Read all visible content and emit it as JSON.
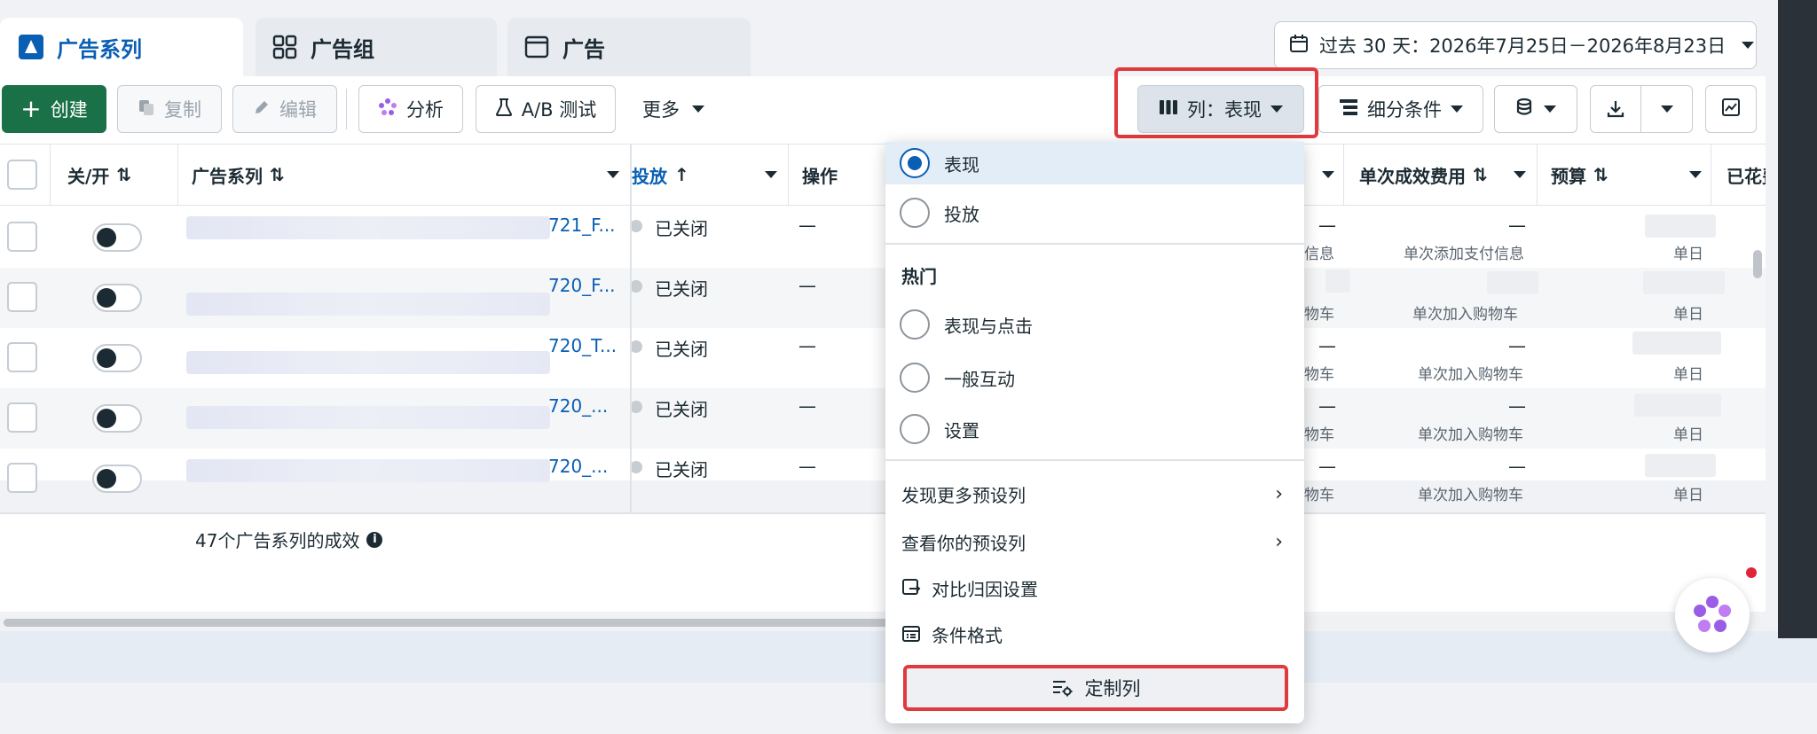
{
  "tabs": [
    {
      "label": "广告系列",
      "icon": "campaign-icon",
      "active": true
    },
    {
      "label": "广告组",
      "icon": "adset-grid-icon",
      "active": false
    },
    {
      "label": "广告",
      "icon": "ad-window-icon",
      "active": false
    }
  ],
  "date_range": {
    "label": "过去 30 天：2026年7月25日－2026年8月23日",
    "icon": "calendar-icon"
  },
  "toolbar": {
    "create": "创建",
    "copy": "复制",
    "edit": "编辑",
    "analyze": "分析",
    "ab_test": "A/B 测试",
    "more": "更多",
    "columns": "列：表现",
    "breakdown": "细分条件"
  },
  "table": {
    "headers": {
      "toggle": "关/开",
      "campaign": "广告系列",
      "delivery": "投放",
      "actions": "操作",
      "cost_per_result": "单次成效费用",
      "budget": "预算",
      "spent": "已花费"
    },
    "rows": [
      {
        "campaign": "721_F...",
        "status": "已关闭",
        "actions": "—",
        "result_sub": "信息",
        "cost": "—",
        "cost_sub": "单次添加支付信息",
        "budget_sub": "单日"
      },
      {
        "campaign": "720_F...",
        "status": "已关闭",
        "actions": "—",
        "result_sub": "物车",
        "cost": "",
        "cost_sub": "单次加入购物车",
        "budget_sub": "单日"
      },
      {
        "campaign": "720_T...",
        "status": "已关闭",
        "actions": "—",
        "result_sub": "物车",
        "cost": "—",
        "cost_sub": "单次加入购物车",
        "budget_sub": "单日"
      },
      {
        "campaign": "720_...",
        "status": "已关闭",
        "actions": "—",
        "result_sub": "物车",
        "cost": "—",
        "cost_sub": "单次加入购物车",
        "budget_sub": "单日"
      },
      {
        "campaign": "720_...",
        "status": "已关闭",
        "actions": "—",
        "result_sub": "物车",
        "cost": "—",
        "cost_sub": "单次加入购物车",
        "budget_sub": "单日"
      }
    ],
    "summary": "47个广告系列的成效"
  },
  "dropdown": {
    "presets": [
      {
        "label": "表现",
        "selected": true
      },
      {
        "label": "投放",
        "selected": false
      }
    ],
    "popular_heading": "热门",
    "popular": [
      {
        "label": "表现与点击",
        "selected": false
      },
      {
        "label": "一般互动",
        "selected": false
      },
      {
        "label": "设置",
        "selected": false
      }
    ],
    "discover_more": "发现更多预设列",
    "view_presets": "查看你的预设列",
    "compare_attribution": "对比归因设置",
    "conditional_format": "条件格式",
    "customize_columns": "定制列"
  },
  "colors": {
    "primary": "#1a7147",
    "link": "#0a5fb4",
    "highlight": "#e03a3e"
  }
}
